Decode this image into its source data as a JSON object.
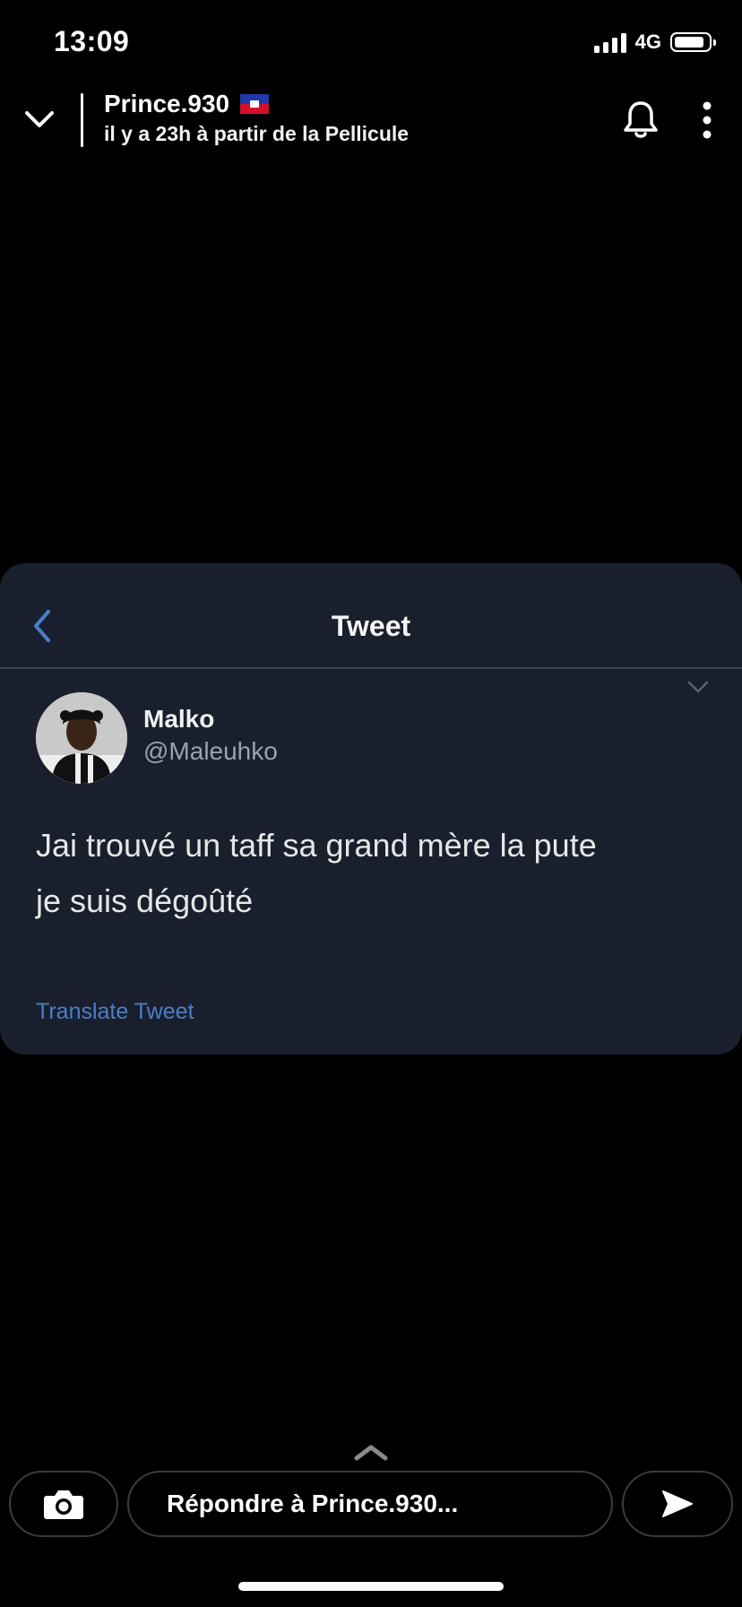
{
  "status_bar": {
    "time": "13:09",
    "network": "4G",
    "battery_level": 0.8,
    "signal_bars": 4
  },
  "header": {
    "username": "Prince.930",
    "flag": "haiti-flag",
    "subtitle": "il y a 23h à partir de la Pellicule"
  },
  "tweet": {
    "title": "Tweet",
    "author_name": "Malko",
    "author_handle": "@Maleuhko",
    "text": "Jai trouvé un taff sa grand mère la pute\nje suis dégoûté",
    "translate_label": "Translate Tweet",
    "colors": {
      "background": "#1a1f2e",
      "link": "#4a7fc6",
      "back_arrow": "#4a7fc6"
    }
  },
  "footer": {
    "reply_placeholder": "Répondre à Prince.930...",
    "icons": [
      "camera-icon",
      "send-icon",
      "chevron-up-icon"
    ]
  }
}
